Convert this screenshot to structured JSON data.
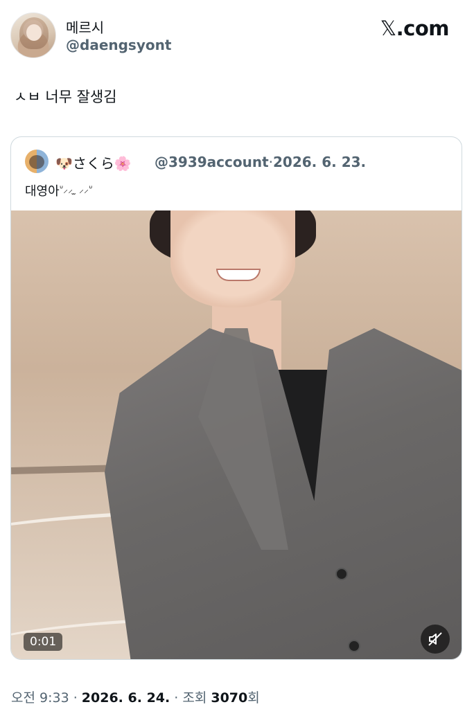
{
  "author": {
    "display_name": "메르시",
    "handle": "@daengsyont"
  },
  "site": {
    "logo_glyph": "𝕏",
    "logo_text": ".com"
  },
  "tweet": {
    "text": "ㅅㅂ 너무 잘생김"
  },
  "quoted": {
    "name": "🐶さくら🌸",
    "handle": "@3939account",
    "separator": "·",
    "date": "2026. 6. 23.",
    "text": "대영아",
    "kaomoji": "ᐡ⸝⸝ ̫ ⸝⸝ᐡ",
    "video": {
      "duration": "0:01",
      "mute_icon": "speaker-muted-icon"
    }
  },
  "footer": {
    "time": "오전 9:33",
    "sep1": " · ",
    "date": "2026. 6. 24.",
    "sep2": " · ",
    "views_label": "조회 ",
    "views_count": "3070",
    "views_suffix": "회"
  },
  "colors": {
    "text_primary": "#0f1419",
    "text_secondary": "#536471",
    "card_border": "#cfd9de"
  }
}
